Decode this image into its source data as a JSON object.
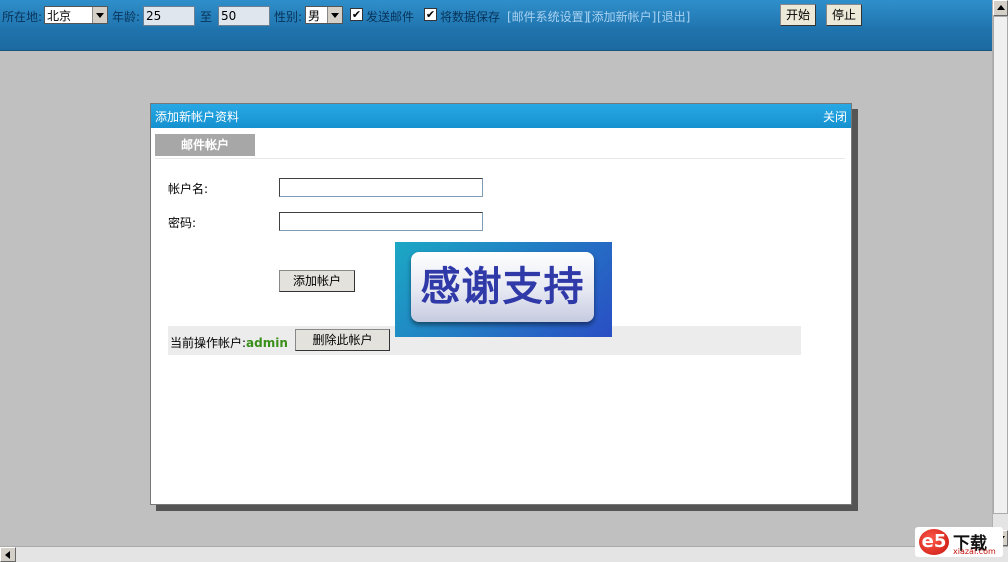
{
  "toolbar": {
    "location_label": "所在地:",
    "location_value": "北京",
    "age_label": "年龄:",
    "age_min": "25",
    "age_to": "至",
    "age_max": "50",
    "gender_label": "性别:",
    "gender_value": "男",
    "send_mail_label": "发送邮件",
    "send_mail_checked": "✔",
    "save_data_label": "将数据保存",
    "save_data_checked": "✔",
    "links": [
      "[邮件系统设置]",
      "[添加新帐户]",
      "[退出]"
    ],
    "start_label": "开始",
    "stop_label": "停止"
  },
  "dialog": {
    "title": "添加新帐户资料",
    "close_label": "关闭",
    "tab_label": "邮件帐户",
    "account_name_label": "帐户名:",
    "account_name_value": "",
    "password_label": "密码:",
    "password_value": "",
    "add_button_label": "添加帐户",
    "current_account_label": "当前操作帐户:",
    "current_account_value": "admin",
    "delete_button_label": "删除此帐户"
  },
  "banner": {
    "text": "感谢支持"
  },
  "watermark": {
    "logo": "e5",
    "text": "下载",
    "url": "xiazai.com"
  },
  "colors": {
    "toolbar_blue": "#2080bc",
    "dialog_title_blue": "#1ea0dc",
    "account_green": "#3a8f1a",
    "backdrop_gray": "#c0c0c0"
  }
}
